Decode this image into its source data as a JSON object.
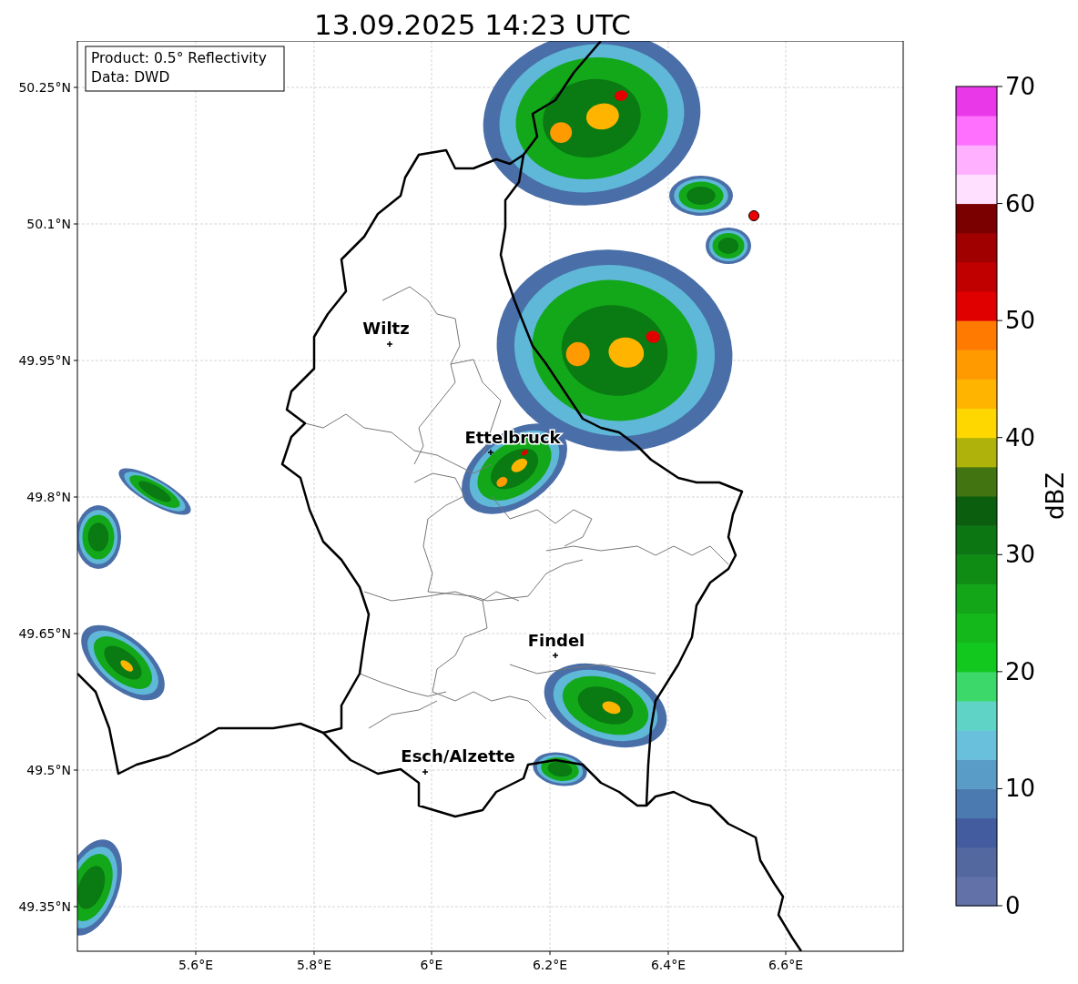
{
  "title": "13.09.2025 14:23 UTC",
  "info_box": {
    "lines": [
      "Product: 0.5° Reflectivity",
      "Data: DWD"
    ]
  },
  "map": {
    "xticks": [
      "5.6°E",
      "5.8°E",
      "6°E",
      "6.2°E",
      "6.4°E",
      "6.6°E"
    ],
    "yticks": [
      "50.25°N",
      "50.1°N",
      "49.95°N",
      "49.8°N",
      "49.65°N",
      "49.5°N",
      "49.35°N"
    ],
    "cities": [
      {
        "name": "Wiltz"
      },
      {
        "name": "Ettelbruck"
      },
      {
        "name": "Findel"
      },
      {
        "name": "Esch/Alzette"
      }
    ]
  },
  "colorbar": {
    "label": "dBZ",
    "ticks": [
      "70",
      "60",
      "50",
      "40",
      "30",
      "20",
      "10",
      "0"
    ]
  }
}
